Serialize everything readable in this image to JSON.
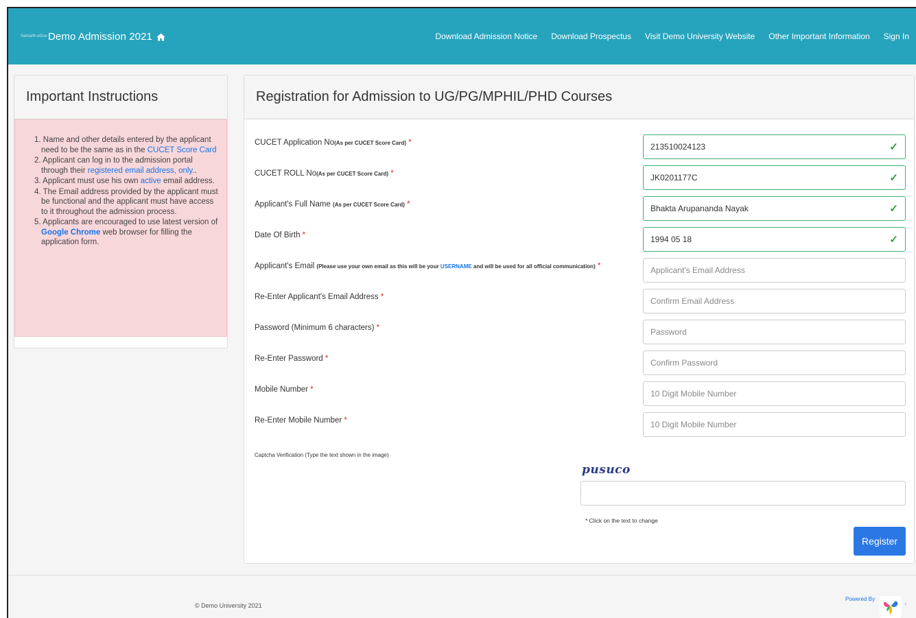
{
  "navbar": {
    "brand_logo": "Samarth eGov",
    "brand_title": "Demo Admission 2021",
    "links": [
      "Download Admission Notice",
      "Download Prospectus",
      "Visit Demo University Website",
      "Other Important Information",
      "Sign In"
    ],
    "background_color": "#26a4bd"
  },
  "instructions": {
    "title": "Important Instructions",
    "items": [
      {
        "num": "1.",
        "a": "Name and other details entered by the applicant need to be the same as in the ",
        "link": "CUCET Score Card",
        "b": ""
      },
      {
        "num": "2.",
        "a": "Applicant can log in to the admission portal through their ",
        "link": "registered email address, only",
        "b": ".."
      },
      {
        "num": "3.",
        "a": "Applicant must use his own ",
        "link": "active",
        "b": " email address."
      },
      {
        "num": "4.",
        "a": "The Email address provided by the applicant must be functional and the applicant must have access to it throughout the admission process.",
        "link": "",
        "b": ""
      },
      {
        "num": "5.",
        "a": "Applicants are encouraged to use latest version of ",
        "link": "Google Chrome",
        "b": " web browser for filling the application form."
      }
    ]
  },
  "form": {
    "title": "Registration for Admission to UG/PG/MPHIL/PHD Courses",
    "required_mark": "*",
    "application_no": {
      "label": "CUCET Application No",
      "note": "(As per CUCET Score Card)",
      "value": "213510024123"
    },
    "roll_no": {
      "label": "CUCET ROLL No",
      "note": "(As per CUCET Score Card)",
      "value": "JK0201177C"
    },
    "full_name": {
      "label": "Applicant's Full Name ",
      "note": "(As per CUCET Score Card)",
      "value": "Bhakta Arupananda Nayak"
    },
    "dob": {
      "label": "Date Of Birth ",
      "value": "1994 05 18"
    },
    "email": {
      "label": "Applicant's Email ",
      "note_a": "(Please use your own email as this will be your ",
      "note_link": "USERNAME",
      "note_b": " and will be used for all official communication)",
      "placeholder": "Applicant's Email Address"
    },
    "email_confirm": {
      "label": "Re-Enter Applicant's Email Address ",
      "placeholder": "Confirm Email Address"
    },
    "password": {
      "label": "Password (Minimum 6 characters) ",
      "placeholder": "Password"
    },
    "password_confirm": {
      "label": "Re-Enter Password ",
      "placeholder": "Confirm Password"
    },
    "mobile": {
      "label": "Mobile Number ",
      "placeholder": "10 Digit Mobile Number"
    },
    "mobile_confirm": {
      "label": "Re-Enter Mobile Number ",
      "placeholder": "10 Digit Mobile Number"
    },
    "valid_mark": "✓",
    "captcha": {
      "label": "Captcha Verification (Type the text shown in the image)",
      "image_text": "pusuco",
      "note": "* Click on the text to change"
    },
    "register_label": "Register",
    "register_color": "#2b78e4"
  },
  "footer": {
    "copyright": "© Demo University 2021",
    "powered_by": "Powered By"
  }
}
